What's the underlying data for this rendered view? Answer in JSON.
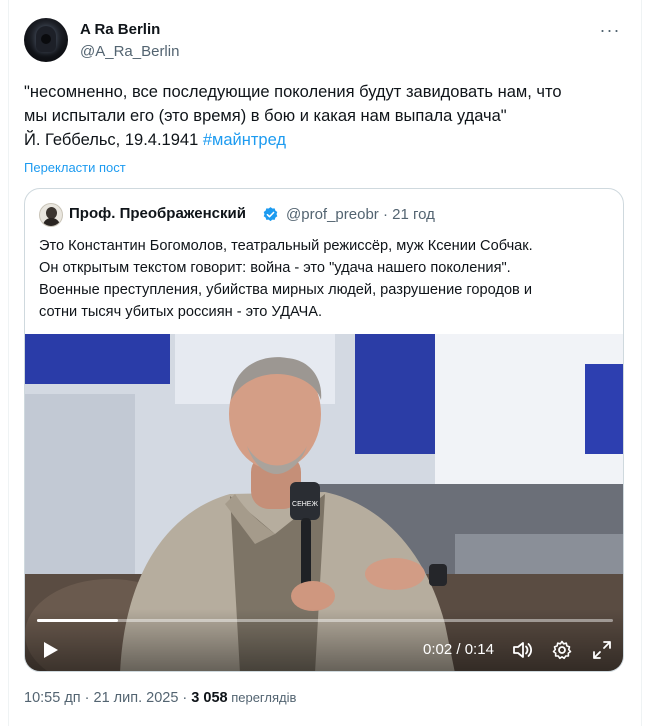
{
  "author": {
    "display_name": "A Ra Berlin",
    "handle": "@A_Ra_Berlin"
  },
  "tweet": {
    "line1": "\"несомненно, все последующие поколения будут завидовать нам, что",
    "line2": "мы испытали его (это время) в бою и какая нам выпала удача\"",
    "line3_prefix": "Й. Геббельс, 19.4.1941",
    "hashtag": "#майнтред",
    "translate_label": "Перекласти пост"
  },
  "quote": {
    "display_name": "Проф. Преображенский",
    "handle_and_time": "@prof_preobr · 21 год",
    "lines": [
      "Это Константин Богомолов, театральный режиссёр, муж Ксении Собчак.",
      "Он открытым текстом говорит: война - это \"удача нашего поколения\".",
      "Военные преступления, убийства мирных людей, разрушение городов и",
      "сотни тысяч убитых россиян - это УДАЧА."
    ],
    "verified_color": "#1d9bf0"
  },
  "video": {
    "current_time": "0:02",
    "separator": " / ",
    "duration": "0:14",
    "progress_fraction": 0.14,
    "mic_label": "СЕНЕЖ"
  },
  "footer": {
    "timestamp": "10:55 дп · 21 лип. 2025 · ",
    "views_count": "3 058",
    "views_label": " переглядів"
  },
  "icons": {
    "more": "more-dots-icon",
    "verified": "verified-badge-icon",
    "play": "play-icon",
    "volume": "volume-icon",
    "settings": "settings-gear-icon",
    "fullscreen": "fullscreen-icon"
  },
  "colors": {
    "link": "#1d9bf0",
    "text": "#0f1419",
    "secondary": "#536471",
    "border": "#cfd9de"
  }
}
